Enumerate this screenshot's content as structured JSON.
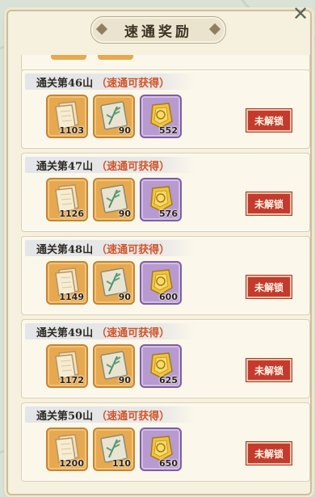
{
  "header": {
    "title": "速通奖励"
  },
  "partial_item_count": 2,
  "stages": [
    {
      "stage": "通关第46山",
      "hint": "（速通可获得）",
      "rewards": [
        {
          "icon": "paper-scroll-icon",
          "qty": "1103"
        },
        {
          "icon": "bamboo-painting-icon",
          "qty": "90"
        },
        {
          "icon": "gold-token-icon",
          "qty": "552"
        }
      ],
      "status": "未解锁"
    },
    {
      "stage": "通关第47山",
      "hint": "（速通可获得）",
      "rewards": [
        {
          "icon": "paper-scroll-icon",
          "qty": "1126"
        },
        {
          "icon": "bamboo-painting-icon",
          "qty": "90"
        },
        {
          "icon": "gold-token-icon",
          "qty": "576"
        }
      ],
      "status": "未解锁"
    },
    {
      "stage": "通关第48山",
      "hint": "（速通可获得）",
      "rewards": [
        {
          "icon": "paper-scroll-icon",
          "qty": "1149"
        },
        {
          "icon": "bamboo-painting-icon",
          "qty": "90"
        },
        {
          "icon": "gold-token-icon",
          "qty": "600"
        }
      ],
      "status": "未解锁"
    },
    {
      "stage": "通关第49山",
      "hint": "（速通可获得）",
      "rewards": [
        {
          "icon": "paper-scroll-icon",
          "qty": "1172"
        },
        {
          "icon": "bamboo-painting-icon",
          "qty": "90"
        },
        {
          "icon": "gold-token-icon",
          "qty": "625"
        }
      ],
      "status": "未解锁"
    },
    {
      "stage": "通关第50山",
      "hint": "（速通可获得）",
      "rewards": [
        {
          "icon": "paper-scroll-icon",
          "qty": "1200"
        },
        {
          "icon": "bamboo-painting-icon",
          "qty": "110"
        },
        {
          "icon": "gold-token-icon",
          "qty": "650"
        }
      ],
      "status": "未解锁"
    }
  ],
  "colors": {
    "hint": "#d0552b",
    "seal": "#c53a2e",
    "slot_orange": "#e6a94f",
    "slot_purple": "#b79ad0",
    "panel": "#f6f0de"
  }
}
